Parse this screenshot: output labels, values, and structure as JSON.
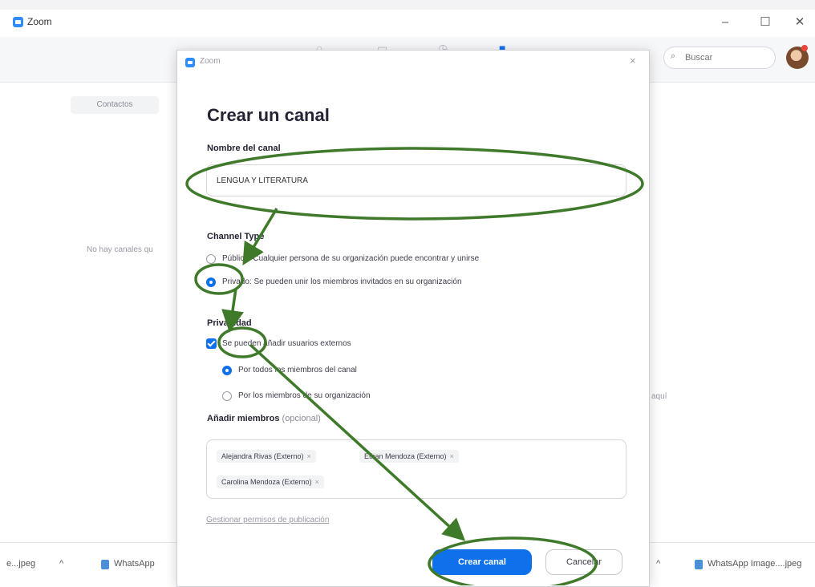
{
  "window": {
    "app_title": "Zoom",
    "minimize_icon": "minimize-icon",
    "maximize_icon": "maximize-icon",
    "close_icon": "close-icon"
  },
  "toolbar": {
    "search_placeholder": "Buscar",
    "search_icon": "search-icon"
  },
  "left_panel": {
    "contacts_tab": "Contactos",
    "empty_text": "No hay canales qu"
  },
  "right_panel": {
    "partial_text": "aquí"
  },
  "downloads": {
    "item1": "e...jpeg",
    "item1_chevron": "^",
    "item2": "WhatsApp",
    "item3_chevron": "^",
    "item3": "WhatsApp Image....jpeg"
  },
  "dialog": {
    "app_title": "Zoom",
    "close": "×",
    "heading": "Crear un canal",
    "name_label": "Nombre del canal",
    "name_value": "LENGUA Y LITERATURA",
    "channel_type_label": "Channel Type",
    "public_option": "Público: Cualquier persona de su organización puede encontrar y unirse",
    "private_option": "Privado: Se pueden unir los miembros invitados en su organización",
    "selected_type": "private",
    "privacy_label": "Privacidad",
    "external_checkbox": "Se pueden añadir usuarios externos",
    "external_checked": true,
    "by_all_members": "Por todos los miembros del canal",
    "by_org_members": "Por los miembros de su organización",
    "selected_adder": "all",
    "add_members_label": "Añadir miembros",
    "add_members_optional": "(opcional)",
    "members": [
      "Alejandra Rivas (Externo)",
      "Ethan Mendoza (Externo)",
      "Carolina Mendoza (Externo)"
    ],
    "chip_remove": "×",
    "permissions_link": "Gestionar permisos de publicación",
    "create_button": "Crear canal",
    "cancel_button": "Cancelar"
  },
  "annotations": {
    "color": "#3f7a2a"
  }
}
